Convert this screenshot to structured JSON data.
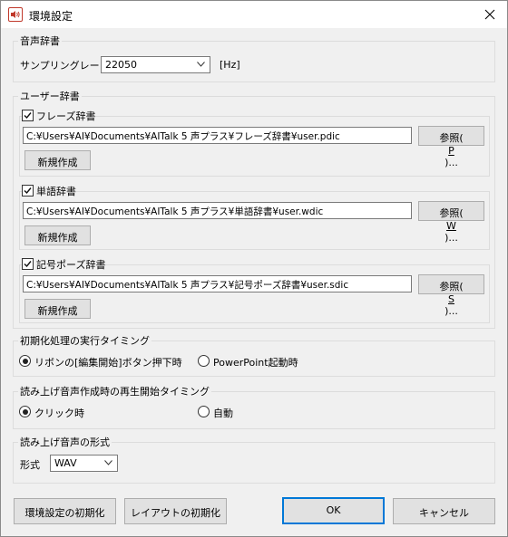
{
  "window": {
    "title": "環境設定"
  },
  "voice_dict": {
    "group_label": "音声辞書",
    "sampling_label": "サンプリングレート",
    "sampling_value": "22050",
    "unit": "[Hz]"
  },
  "user_dict": {
    "group_label": "ユーザー辞書",
    "sections": [
      {
        "label": "フレーズ辞書",
        "checked": true,
        "path": "C:¥Users¥AI¥Documents¥AITalk 5 声プラス¥フレーズ辞書¥user.pdic",
        "browse_pre": "参照(",
        "browse_key": "P",
        "browse_post": ")...",
        "new_label": "新規作成"
      },
      {
        "label": "単語辞書",
        "checked": true,
        "path": "C:¥Users¥AI¥Documents¥AITalk 5 声プラス¥単語辞書¥user.wdic",
        "browse_pre": "参照(",
        "browse_key": "W",
        "browse_post": ")...",
        "new_label": "新規作成"
      },
      {
        "label": "記号ポーズ辞書",
        "checked": true,
        "path": "C:¥Users¥AI¥Documents¥AITalk 5 声プラス¥記号ポーズ辞書¥user.sdic",
        "browse_pre": "参照(",
        "browse_key": "S",
        "browse_post": ")...",
        "new_label": "新規作成"
      }
    ]
  },
  "init_timing": {
    "group_label": "初期化処理の実行タイミング",
    "options": [
      "リボンの[編集開始]ボタン押下時",
      "PowerPoint起動時"
    ],
    "selected": 0
  },
  "playback_timing": {
    "group_label": "読み上げ音声作成時の再生開始タイミング",
    "options": [
      "クリック時",
      "自動"
    ],
    "selected": 0
  },
  "audio_format": {
    "group_label": "読み上げ音声の形式",
    "format_label": "形式",
    "format_value": "WAV"
  },
  "footer": {
    "reset_settings": "環境設定の初期化",
    "reset_layout": "レイアウトの初期化",
    "ok": "OK",
    "cancel": "キャンセル"
  }
}
